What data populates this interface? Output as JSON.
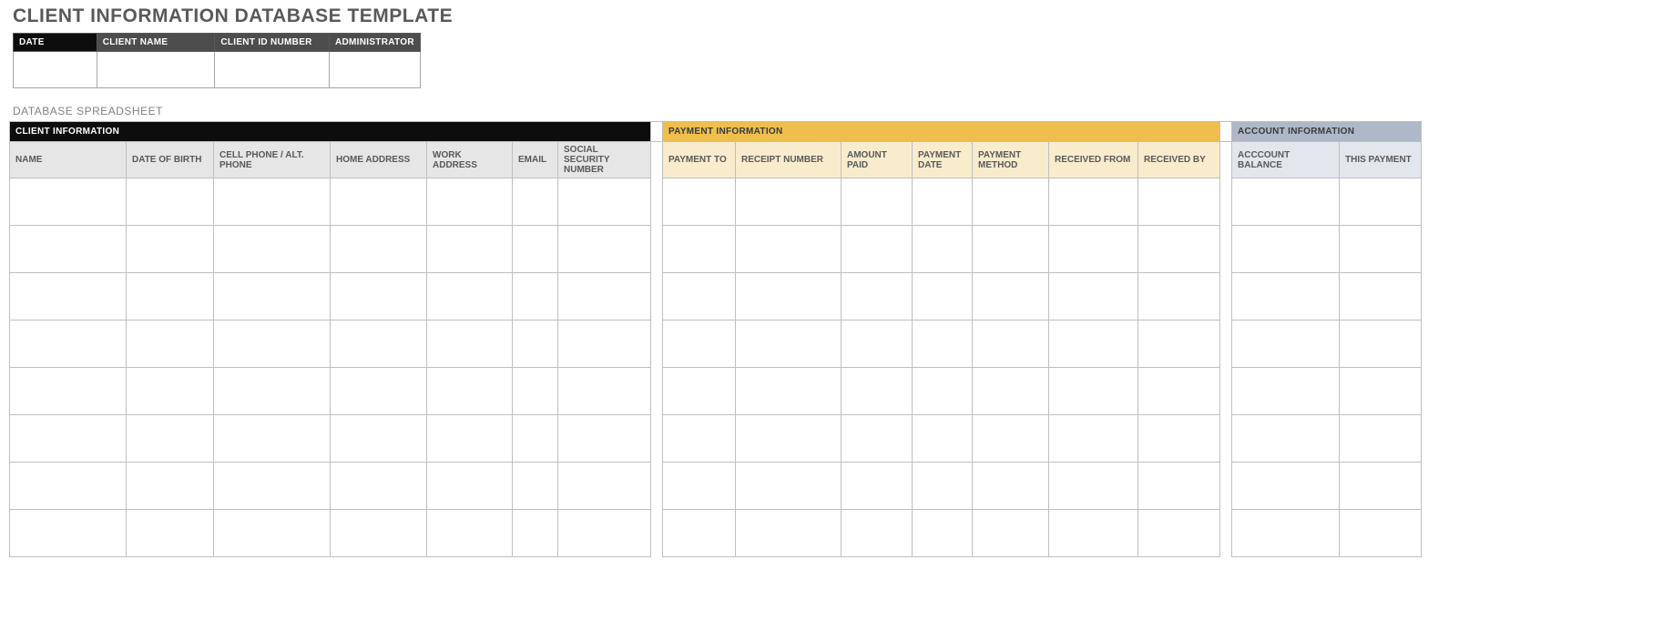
{
  "title": "CLIENT INFORMATION DATABASE TEMPLATE",
  "meta": {
    "headers": [
      "DATE",
      "CLIENT NAME",
      "CLIENT ID NUMBER",
      "ADMINISTRATOR"
    ],
    "values": [
      "",
      "",
      "",
      ""
    ]
  },
  "section_label": "DATABASE SPREADSHEET",
  "groups": {
    "client": "CLIENT INFORMATION",
    "payment": "PAYMENT INFORMATION",
    "account": "ACCOUNT INFORMATION"
  },
  "columns": {
    "client": [
      "NAME",
      "DATE OF BIRTH",
      "CELL PHONE / ALT. PHONE",
      "HOME ADDRESS",
      "WORK ADDRESS",
      "EMAIL",
      "SOCIAL SECURITY NUMBER"
    ],
    "payment": [
      "PAYMENT TO",
      "RECEIPT NUMBER",
      "AMOUNT PAID",
      "PAYMENT DATE",
      "PAYMENT METHOD",
      "RECEIVED FROM",
      "RECEIVED BY"
    ],
    "account": [
      "ACCCOUNT BALANCE",
      "THIS PAYMENT"
    ]
  },
  "row_count": 8
}
